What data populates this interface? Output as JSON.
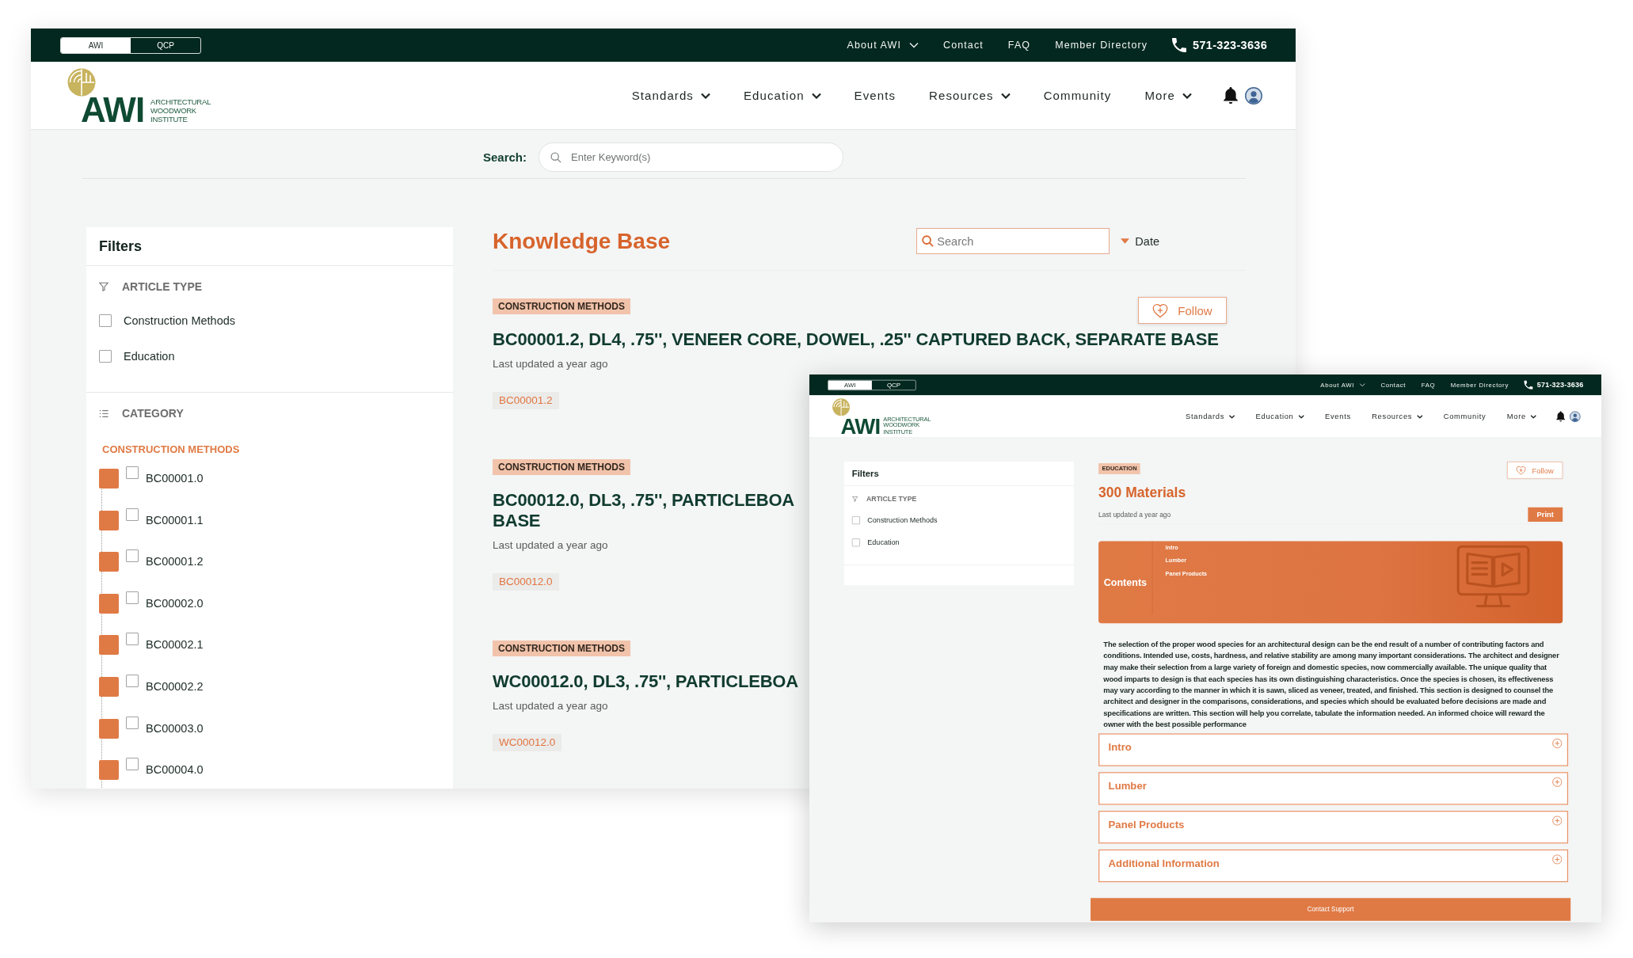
{
  "windows": [
    {
      "kind": "listing",
      "header": {
        "site_switch": [
          {
            "label": "AWI",
            "selected": true
          },
          {
            "label": "QCP",
            "selected": false
          }
        ],
        "utility_links": [
          {
            "label": "About AWI",
            "dropdown": true
          },
          {
            "label": "Contact",
            "dropdown": false
          },
          {
            "label": "FAQ",
            "dropdown": false
          },
          {
            "label": "Member Directory",
            "dropdown": false
          }
        ],
        "phone": "571-323-3636",
        "logo": {
          "mark": "AWI",
          "subtitle": [
            "ARCHITECTURAL",
            "WOODWORK",
            "INSTITUTE"
          ]
        },
        "nav": [
          {
            "label": "Standards",
            "dropdown": true
          },
          {
            "label": "Education",
            "dropdown": true
          },
          {
            "label": "Events",
            "dropdown": false
          },
          {
            "label": "Resources",
            "dropdown": true
          },
          {
            "label": "Community",
            "dropdown": false
          },
          {
            "label": "More",
            "dropdown": true
          }
        ]
      },
      "keyword_search": {
        "label": "Search:",
        "placeholder": "Enter Keyword(s)"
      },
      "filters": {
        "title": "Filters",
        "article_type": {
          "heading": "ARTICLE TYPE",
          "options": [
            {
              "label": "Construction Methods",
              "checked": false
            },
            {
              "label": "Education",
              "checked": false
            }
          ]
        },
        "category": {
          "heading": "CATEGORY",
          "groups": [
            {
              "label": "CONSTRUCTION METHODS",
              "children": [
                {
                  "label": "BC00001.0",
                  "checked": false
                },
                {
                  "label": "BC00001.1",
                  "checked": false
                },
                {
                  "label": "BC00001.2",
                  "checked": false
                },
                {
                  "label": "BC00002.0",
                  "checked": false
                },
                {
                  "label": "BC00002.1",
                  "checked": false
                },
                {
                  "label": "BC00002.2",
                  "checked": false
                },
                {
                  "label": "BC00003.0",
                  "checked": false
                },
                {
                  "label": "BC00004.0",
                  "checked": false
                }
              ]
            }
          ]
        }
      },
      "main": {
        "title": "Knowledge Base",
        "search": {
          "placeholder": "Search"
        },
        "sort": {
          "label": "Date"
        },
        "articles": [
          {
            "tag": "CONSTRUCTION METHODS",
            "follow": "Follow",
            "title_lines": [
              "BC00001.2, DL4, .75'', VENEER CORE, DOWEL, .25'' CAPTURED BACK, SEPARATE BASE"
            ],
            "updated": "Last updated a year ago",
            "code": "BC00001.2"
          },
          {
            "tag": "CONSTRUCTION METHODS",
            "title_lines": [
              "BC00012.0, DL3, .75'', PARTICLEBOA",
              "BASE"
            ],
            "updated": "Last updated a year ago",
            "code": "BC00012.0"
          },
          {
            "tag": "CONSTRUCTION METHODS",
            "title_lines": [
              "WC00012.0, DL3, .75'', PARTICLEBOA"
            ],
            "updated": "Last updated a year ago",
            "code": "WC00012.0"
          }
        ]
      }
    },
    {
      "kind": "article",
      "header": {
        "site_switch": [
          {
            "label": "AWI",
            "selected": true
          },
          {
            "label": "QCP",
            "selected": false
          }
        ],
        "utility_links": [
          {
            "label": "About AWI",
            "dropdown": true
          },
          {
            "label": "Contact",
            "dropdown": false
          },
          {
            "label": "FAQ",
            "dropdown": false
          },
          {
            "label": "Member Directory",
            "dropdown": false
          }
        ],
        "phone": "571-323-3636",
        "logo": {
          "mark": "AWI",
          "subtitle": [
            "ARCHITECTURAL",
            "WOODWORK",
            "INSTITUTE"
          ]
        },
        "nav": [
          {
            "label": "Standards",
            "dropdown": true
          },
          {
            "label": "Education",
            "dropdown": true
          },
          {
            "label": "Events",
            "dropdown": false
          },
          {
            "label": "Resources",
            "dropdown": true
          },
          {
            "label": "Community",
            "dropdown": false
          },
          {
            "label": "More",
            "dropdown": true
          }
        ]
      },
      "filters": {
        "title": "Filters",
        "article_type": {
          "heading": "ARTICLE TYPE",
          "options": [
            {
              "label": "Construction Methods",
              "checked": false
            },
            {
              "label": "Education",
              "checked": false
            }
          ]
        }
      },
      "article": {
        "tag": "EDUCATION",
        "follow": "Follow",
        "title": "300 Materials",
        "updated": "Last updated a year ago",
        "print": "Print",
        "contents": {
          "label": "Contents",
          "items": [
            "Intro",
            "Lumber",
            "Panel Products"
          ]
        },
        "body": "The selection of the proper wood species for an architectural design can be the end result of a number of contributing factors and conditions. Intended use, costs, hardness, and relative stability are among many important considerations. The architect and designer may make their selection from a large variety of foreign and domestic species, now commercially available. The unique quality that wood imparts to design is that each species has its own distinguishing characteristics. Once the species is chosen, its effectiveness may vary according to the manner in which it is sawn, sliced as veneer, treated, and finished. This section is designed to counsel the architect and designer in the comparisons, considerations, and species which should be evaluated before decisions are made and specifications are written. This section will help you correlate, tabulate the information needed. An informed choice will reward the owner with the best possible performance",
        "sections": [
          {
            "title": "Intro",
            "expanded": false
          },
          {
            "title": "Lumber",
            "expanded": false
          },
          {
            "title": "Panel Products",
            "expanded": false
          },
          {
            "title": "Additional Information",
            "expanded": false
          }
        ],
        "support": "Contact Support"
      }
    }
  ]
}
